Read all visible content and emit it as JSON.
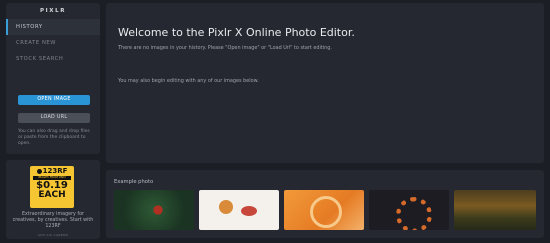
{
  "sidebar": {
    "logo": "PIXLR",
    "nav": [
      "HISTORY",
      "CREATE NEW",
      "STOCK SEARCH"
    ],
    "open_image": "OPEN IMAGE",
    "load_url": "LOAD URL",
    "drag_hint": "You can also drag and drop files or paste from the clipboard to open."
  },
  "ad": {
    "brand": "123RF",
    "strip": "IMAGES FROM ONLY",
    "price": "$0.19",
    "each": "EACH",
    "text": "Extraordinary imagery for creatives, by creatives. Start with 123RF",
    "tag": "ADS VIA CARBON"
  },
  "main": {
    "title": "Welcome to the Pixlr X Online Photo Editor.",
    "no_images": "There are no images in your history. Please \"Open image\" or \"Load Url\" to start editing.",
    "also": "You may also begin editing with any of our images below."
  },
  "examples": {
    "label": "Example photo",
    "photos": [
      {
        "icon": "red-leaf-photo"
      },
      {
        "icon": "spices-photo"
      },
      {
        "icon": "orange-pattern-photo"
      },
      {
        "icon": "wreath-photo"
      },
      {
        "icon": "autumn-forest-photo"
      }
    ]
  },
  "colors": {
    "background": "#1b1e24",
    "panel": "#252830",
    "accent": "#2a95d6",
    "ad_yellow": "#f6c532"
  }
}
